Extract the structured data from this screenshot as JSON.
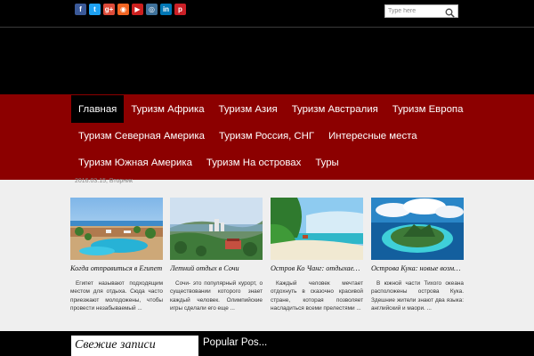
{
  "social": [
    {
      "icon": "facebook-icon",
      "glyph": "f",
      "color": "#3b5998"
    },
    {
      "icon": "twitter-icon",
      "glyph": "t",
      "color": "#1da1f2"
    },
    {
      "icon": "google-plus-icon",
      "glyph": "g+",
      "color": "#dd4b39"
    },
    {
      "icon": "rss-icon",
      "glyph": "◉",
      "color": "#f26522"
    },
    {
      "icon": "youtube-icon",
      "glyph": "▶",
      "color": "#cd201f"
    },
    {
      "icon": "instagram-icon",
      "glyph": "◎",
      "color": "#3f729b"
    },
    {
      "icon": "linkedin-icon",
      "glyph": "in",
      "color": "#0077b5"
    },
    {
      "icon": "pinterest-icon",
      "glyph": "p",
      "color": "#cb2027"
    }
  ],
  "search": {
    "placeholder": "Type here"
  },
  "nav": {
    "active": "Главная",
    "items": [
      "Главная",
      "Туризм Африка",
      "Туризм Азия",
      "Туризм Австралия",
      "Туризм Европа",
      "Туризм Северная Америка",
      "Туризм Россия, СНГ",
      "Интересные места",
      "Туризм Южная Америка",
      "Туризм На островах",
      "Туры"
    ]
  },
  "date": "2016.03.15, Вторник",
  "posts": [
    {
      "title": "Когда отправиться в Египет",
      "excerpt": "Египет называют подходящим местом для отдыха. Сюда часто приезжают молодожены, чтобы провести незабываемый ..."
    },
    {
      "title": "Летний отдых в Сочи",
      "excerpt": "Сочи- это популярный курорт, о существовании которого знает каждый человек. Олимпийские игры сделали его еще ..."
    },
    {
      "title": "Остров Ко Чанг: отдыхаем вс...",
      "excerpt": "Каждый человек мечтает отдохнуть в сказочно красивой стране, которая позволяет насладиться всеми прелестями ..."
    },
    {
      "title": "Острова Кука: новые возмож...",
      "excerpt": "В южной части Тихого океана расположены острова Кука. Здешние жители знают два языка: английский и маори. ..."
    }
  ],
  "widgets": {
    "recent": "Свежие записи",
    "popular": "Popular Pos..."
  },
  "colors": {
    "nav_bg": "#8c0000",
    "active_bg": "#000000",
    "content_bg": "#efefef"
  }
}
